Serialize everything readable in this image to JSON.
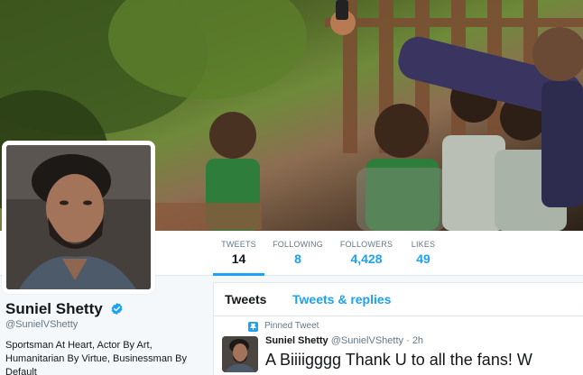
{
  "profile": {
    "name": "Suniel Shetty",
    "handle": "@SunielVShetty",
    "bio": "Sportsman At Heart, Actor By Art, Humanitarian By Virtue, Businessman By Default"
  },
  "stats": [
    {
      "label": "TWEETS",
      "value": "14"
    },
    {
      "label": "FOLLOWING",
      "value": "8"
    },
    {
      "label": "FOLLOWERS",
      "value": "4,428"
    },
    {
      "label": "LIKES",
      "value": "49"
    }
  ],
  "timeline": {
    "tabs": [
      "Tweets",
      "Tweets & replies"
    ]
  },
  "tweet": {
    "pinned_label": "Pinned Tweet",
    "author": "Suniel Shetty",
    "handle": "@SunielVShetty",
    "dot": "·",
    "time": "2h",
    "text": "A Biiiigggg Thank U to all the fans! W"
  },
  "colors": {
    "accent": "#1da1f2",
    "text": "#14171a",
    "muted": "#657786",
    "border": "#e1e8ed"
  },
  "icons": {
    "verified": "verified-badge-icon",
    "pin": "pin-icon"
  }
}
